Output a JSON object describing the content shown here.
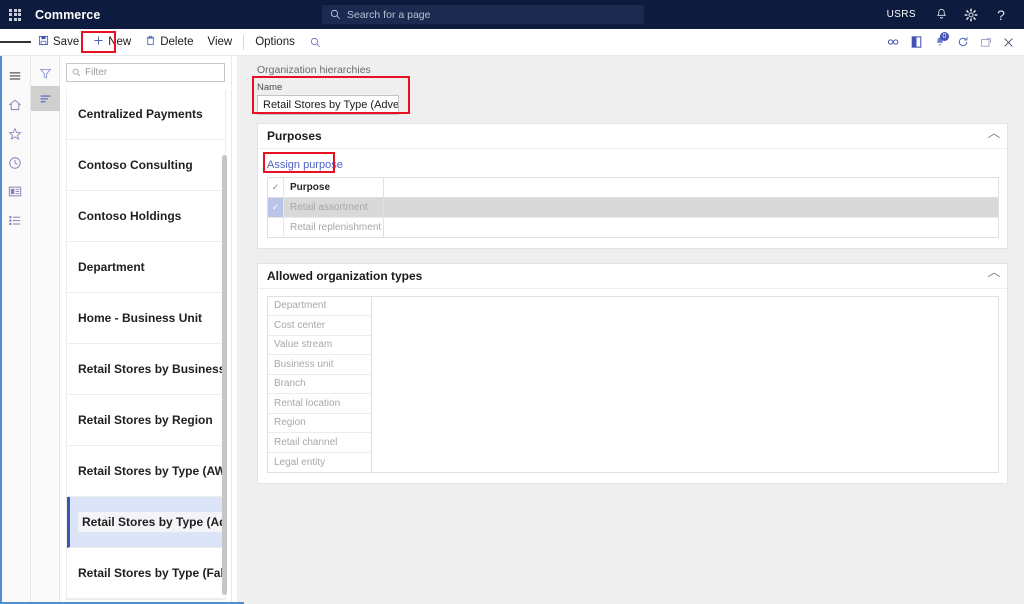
{
  "topbar": {
    "waffle_icon": "app-launcher-icon",
    "app_title": "Commerce",
    "search_placeholder": "Search for a page",
    "search_icon": "search-icon",
    "company": "USRS",
    "icons": [
      "bell-icon",
      "gear-icon",
      "help-icon"
    ]
  },
  "toolbar": {
    "menu_icon": "hamburger-icon",
    "save_label": "Save",
    "save_icon": "save-icon",
    "new_label": "New",
    "new_icon": "plus-icon",
    "delete_label": "Delete",
    "delete_icon": "trash-icon",
    "view_label": "View",
    "options_label": "Options",
    "search_icon": "search-icon",
    "right_icons": [
      {
        "name": "attach-icon",
        "glyph": "∞"
      },
      {
        "name": "office-icon",
        "glyph": "◐"
      },
      {
        "name": "notifications-icon",
        "glyph": "🔔",
        "badge": "0"
      },
      {
        "name": "refresh-icon",
        "glyph": "↻"
      },
      {
        "name": "popout-icon",
        "glyph": "↗"
      },
      {
        "name": "close-icon",
        "glyph": "✕"
      }
    ]
  },
  "rail": {
    "icons": [
      {
        "name": "hamburger-icon"
      },
      {
        "name": "home-icon"
      },
      {
        "name": "favorites-star-icon"
      },
      {
        "name": "recent-clock-icon"
      },
      {
        "name": "workspaces-icon"
      },
      {
        "name": "modules-list-icon"
      }
    ]
  },
  "rail2": {
    "filter_icon": "filter-icon",
    "list_icon": "list-view-icon"
  },
  "list_panel": {
    "filter_placeholder": "Filter",
    "filter_icon": "search-icon",
    "items": [
      {
        "label": "Centralized Payments",
        "selected": false
      },
      {
        "label": "Contoso Consulting",
        "selected": false
      },
      {
        "label": "Contoso Holdings",
        "selected": false
      },
      {
        "label": "Department",
        "selected": false
      },
      {
        "label": "Home - Business Unit",
        "selected": false
      },
      {
        "label": "Retail Stores by Business Unit",
        "selected": false
      },
      {
        "label": "Retail Stores by Region",
        "selected": false
      },
      {
        "label": "Retail Stores by Type (AW)",
        "selected": false
      },
      {
        "label": "Retail Stores by Type (Advent",
        "selected": true
      },
      {
        "label": "Retail Stores by Type (Fabrik..",
        "selected": false
      }
    ]
  },
  "main": {
    "breadcrumb": "Organization hierarchies",
    "name_label": "Name",
    "name_value": "Retail Stores by Type (Adventur...",
    "purposes": {
      "title": "Purposes",
      "assign_label": "Assign purpose",
      "collapse_icon": "chevron-up-icon",
      "column_header": "Purpose",
      "rows": [
        {
          "label": "Retail assortment",
          "checked": true,
          "selected": true
        },
        {
          "label": "Retail replenishment",
          "checked": false,
          "selected": false
        }
      ]
    },
    "allowed_types": {
      "title": "Allowed organization types",
      "collapse_icon": "chevron-up-icon",
      "rows": [
        "Department",
        "Cost center",
        "Value stream",
        "Business unit",
        "Branch",
        "Rental location",
        "Region",
        "Retail channel",
        "Legal entity"
      ]
    }
  },
  "colors": {
    "header_bg": "#0d1b3e",
    "accent_link": "#4d62c4",
    "highlight_box": "#e81123",
    "selection_bg": "#dce4f7",
    "selection_bar": "#3b55b0",
    "bottom_accent": "#4f8ecf"
  }
}
